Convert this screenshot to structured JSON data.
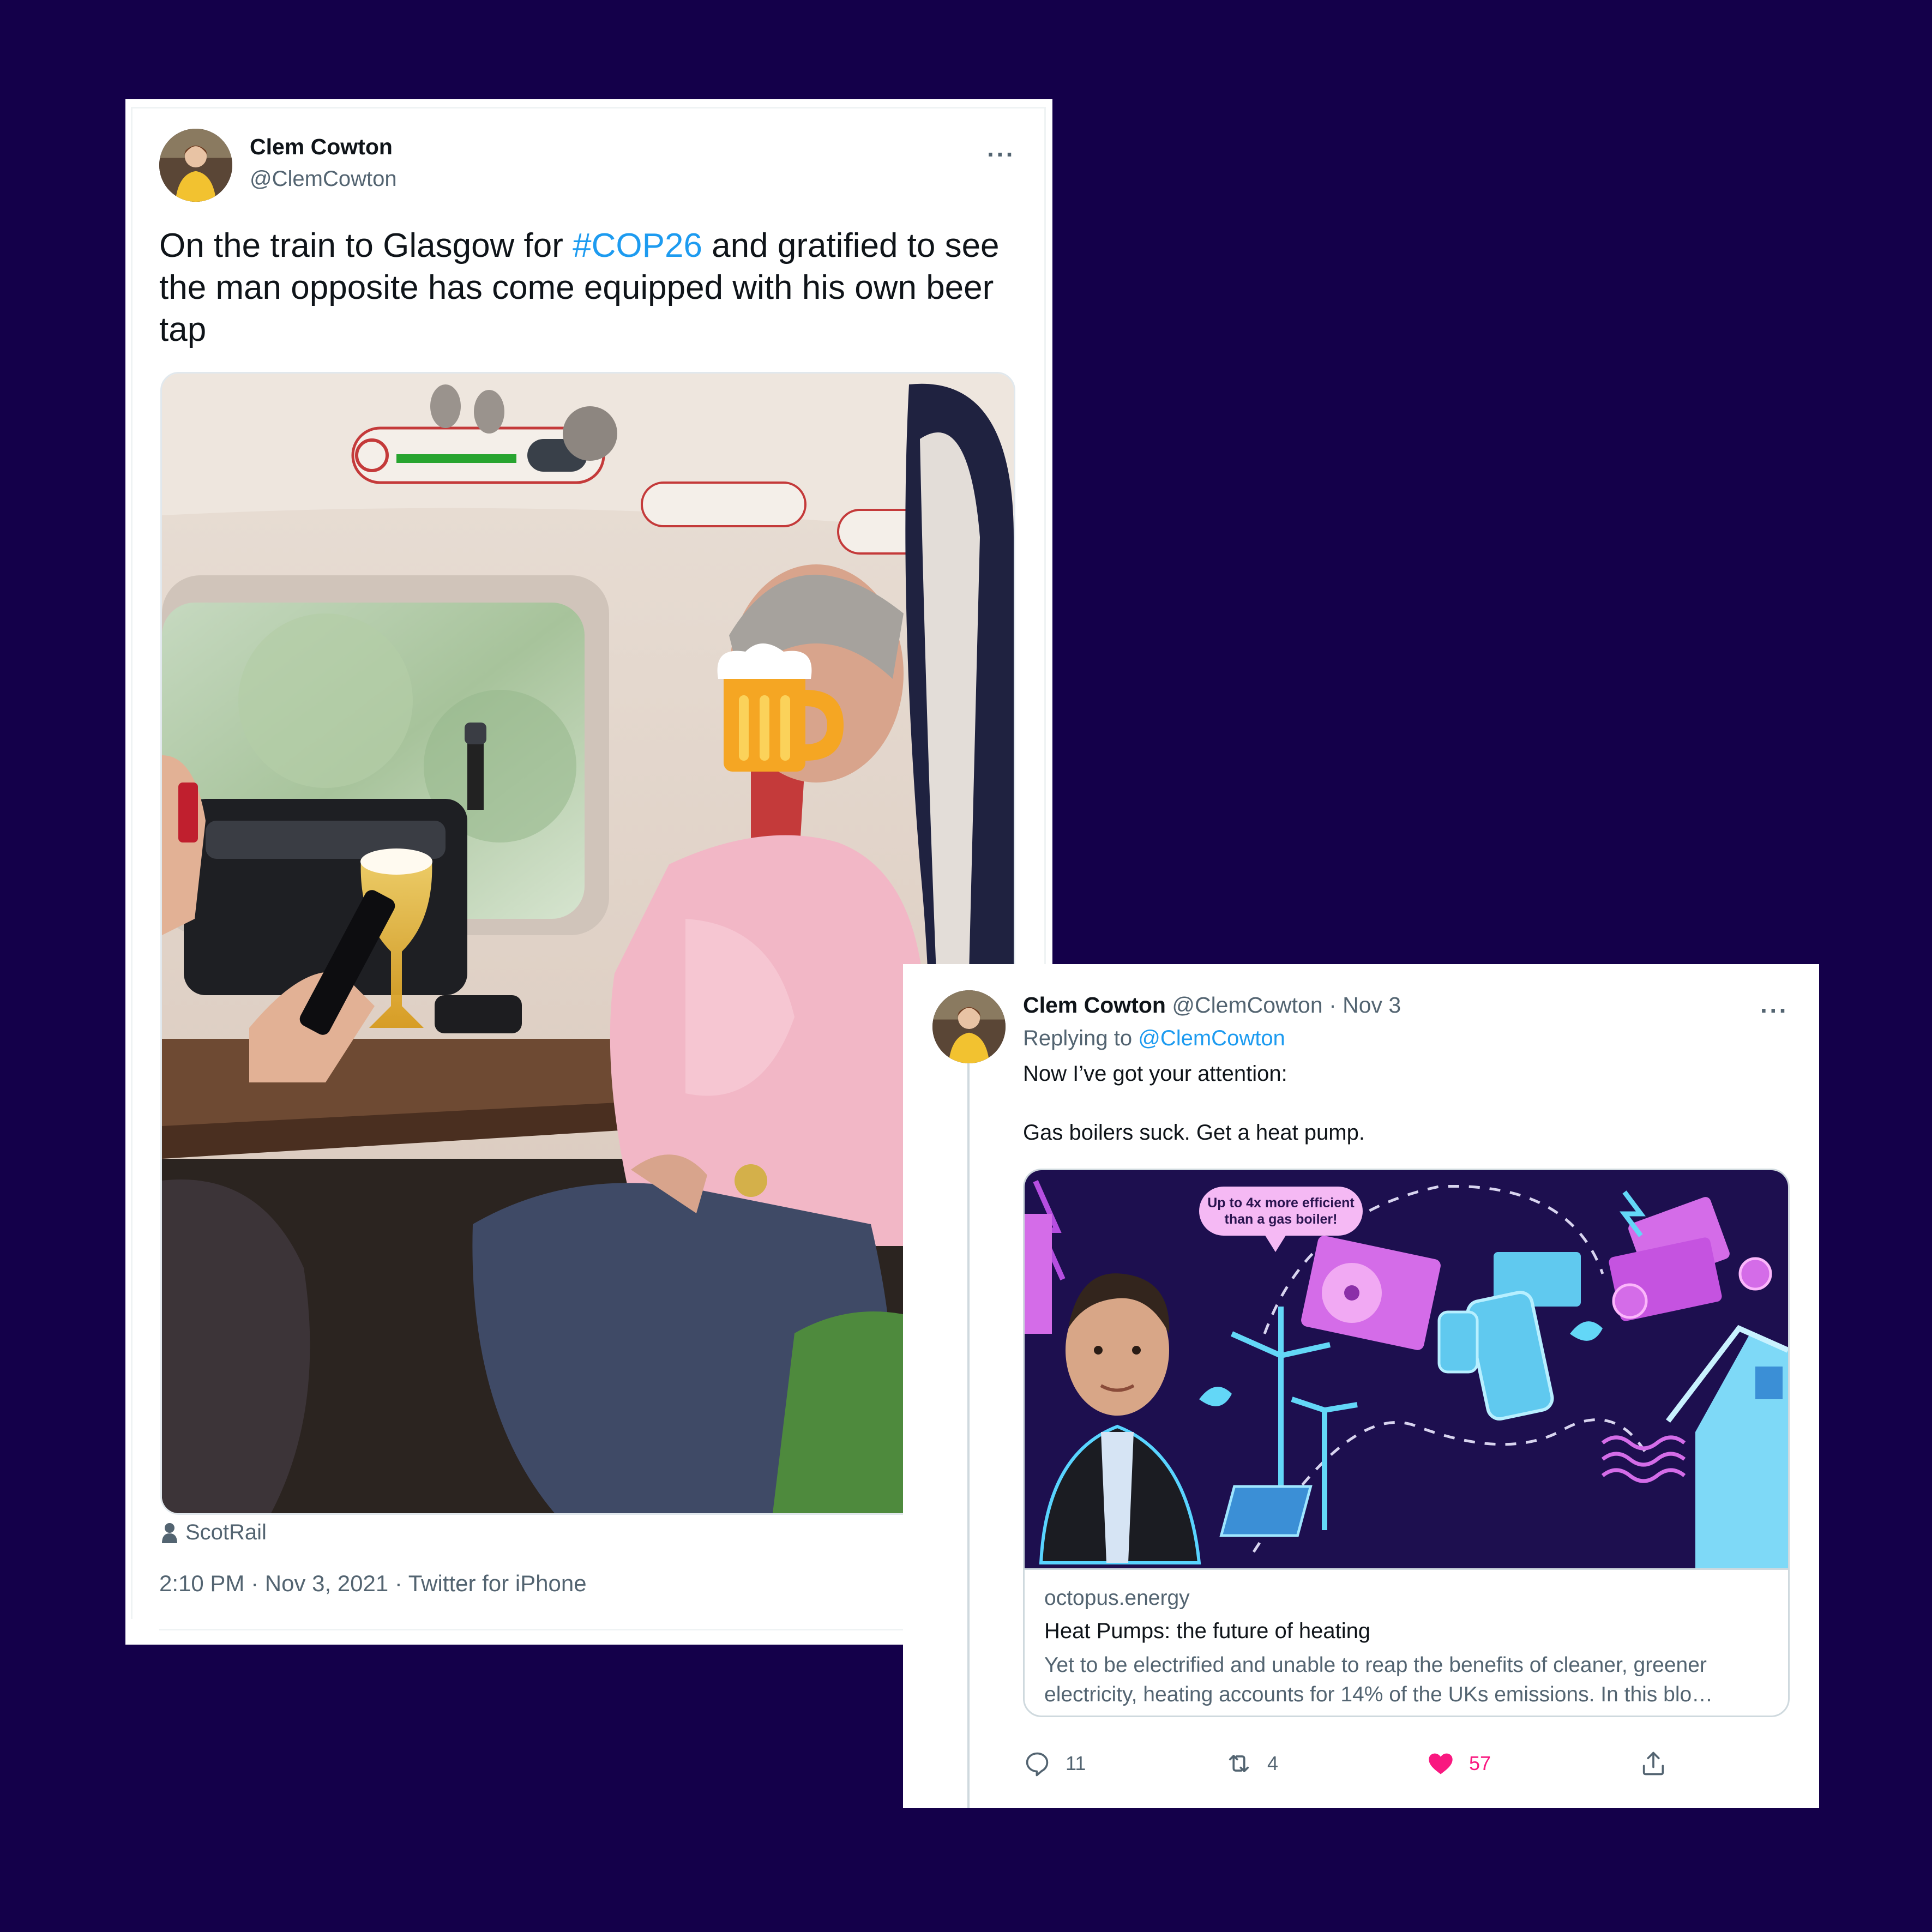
{
  "tweet1": {
    "author_name": "Clem Cowton",
    "author_handle": "@ClemCowton",
    "more_icon": "more-icon",
    "text_before": "On the train to Glasgow for ",
    "hashtag": "#COP26",
    "text_after": " and gratified to see the man opposite has come equipped with his own beer tap",
    "media_alt": "photo of a man on a train beside a beer tap, face covered with a beer mug emoji",
    "place_icon": "person-icon",
    "place": "ScotRail",
    "meta": "2:10 PM · Nov 3, 2021 · Twitter for iPhone"
  },
  "tweet2": {
    "author_name": "Clem Cowton",
    "author_handle": "@ClemCowton",
    "date": "· Nov 3",
    "replying_prefix": "Replying to ",
    "replying_to": "@ClemCowton",
    "text_line1": "Now I’ve got your attention:",
    "text_line2": "Gas boilers suck. Get a heat pump.",
    "link_card": {
      "image_bubble": [
        "Up to 4x more efficient",
        "than a gas boiler!"
      ],
      "domain": "octopus.energy",
      "title": "Heat Pumps: the future of heating",
      "description": "Yet to be electrified and unable to reap the benefits of cleaner, greener electricity, heating accounts for 14% of the UKs emissions. In this blo…"
    },
    "actions": {
      "reply_count": "11",
      "retweet_count": "4",
      "like_count": "57"
    }
  },
  "colors": {
    "background": "#14004a",
    "link": "#1d9bf0",
    "like": "#f91880",
    "secondary_text": "#536471"
  }
}
